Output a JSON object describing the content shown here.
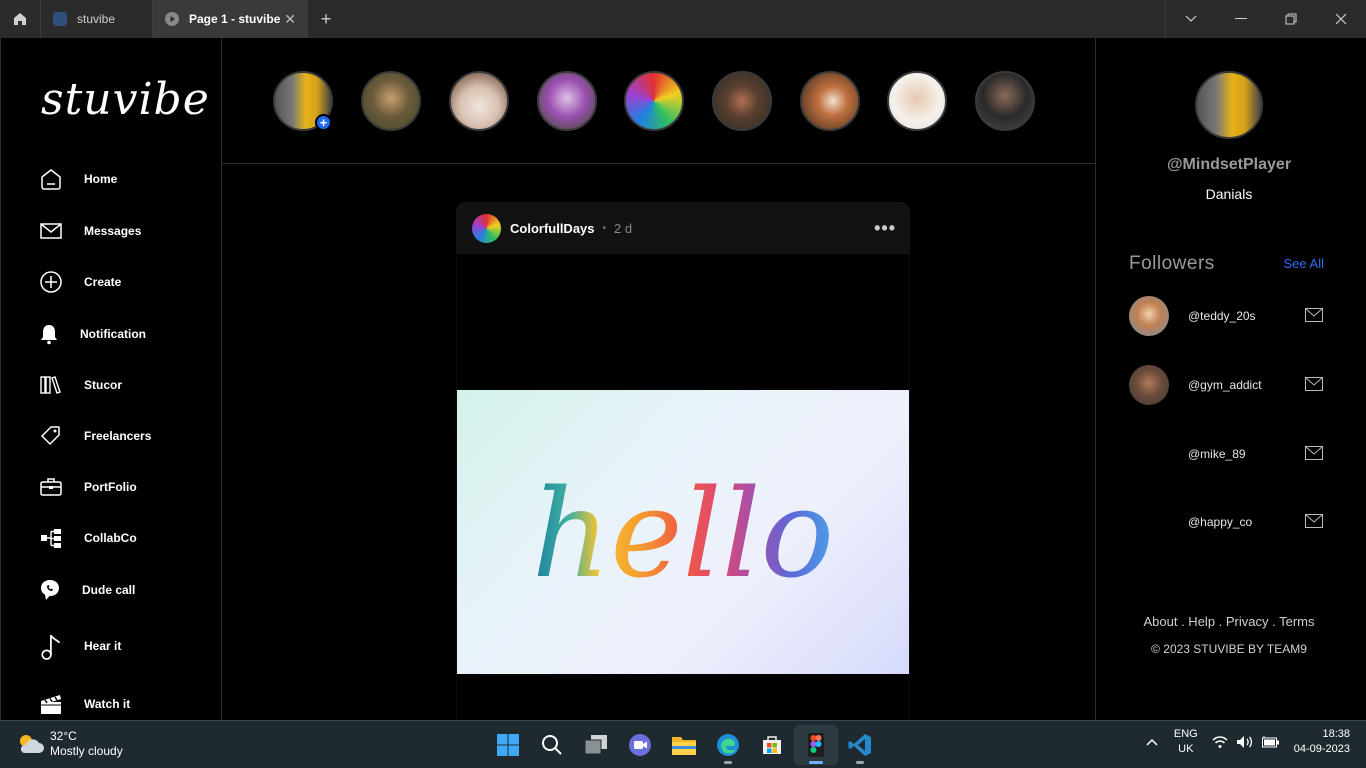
{
  "browser": {
    "tabs": [
      {
        "label": "stuvibe"
      },
      {
        "label": "Page 1 - stuvibe"
      }
    ]
  },
  "sidebar": {
    "logo": "stuvibe",
    "items": [
      {
        "label": "Home",
        "icon": "home-icon"
      },
      {
        "label": "Messages",
        "icon": "mail-icon"
      },
      {
        "label": "Create",
        "icon": "plus-circle-icon"
      },
      {
        "label": "Notification",
        "icon": "bell-icon"
      },
      {
        "label": "Stucor",
        "icon": "books-icon"
      },
      {
        "label": "Freelancers",
        "icon": "tag-icon"
      },
      {
        "label": "PortFolio",
        "icon": "briefcase-icon"
      },
      {
        "label": "CollabCo",
        "icon": "hierarchy-icon"
      },
      {
        "label": "Dude call",
        "icon": "chat-call-icon"
      },
      {
        "label": "Hear it",
        "icon": "music-note-icon"
      },
      {
        "label": "Watch it",
        "icon": "clapperboard-icon"
      }
    ]
  },
  "post": {
    "username": "ColorfullDays",
    "time": "2 d",
    "image_text": "hello"
  },
  "profile": {
    "handle": "@MindsetPlayer",
    "name": "Danials"
  },
  "followers": {
    "title": "Followers",
    "see_all": "See All",
    "list": [
      {
        "handle": "@teddy_20s"
      },
      {
        "handle": "@gym_addict"
      },
      {
        "handle": "@mike_89"
      },
      {
        "handle": "@happy_co"
      }
    ]
  },
  "footer": {
    "links": "About . Help . Privacy . Terms",
    "copyright": "© 2023 STUVIBE BY TEAM9"
  },
  "taskbar": {
    "temp": "32°C",
    "weather": "Mostly cloudy",
    "lang_top": "ENG",
    "lang_bottom": "UK",
    "time": "18:38",
    "date": "04-09-2023"
  },
  "colors": {
    "accent": "#2f6df0",
    "background": "#000000",
    "taskbar": "#1f2a30"
  }
}
